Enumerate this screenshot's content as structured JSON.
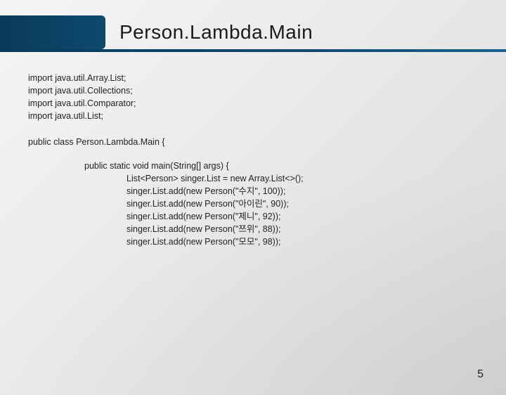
{
  "title": "Person.Lambda.Main",
  "imports": [
    "import java.util.Array.List;",
    "import java.util.Collections;",
    "import java.util.Comparator;",
    "import java.util.List;"
  ],
  "class_declaration": "public class Person.Lambda.Main {",
  "method_signature": "public static void main(String[] args) {",
  "method_body": [
    "List<Person> singer.List = new Array.List<>();",
    "singer.List.add(new Person(\"수지\", 100));",
    "singer.List.add(new Person(\"아이린\", 90));",
    "singer.List.add(new Person(\"제니\", 92));",
    "singer.List.add(new Person(\"쯔위\", 88));",
    "singer.List.add(new Person(\"모모\", 98));"
  ],
  "page_number": "5"
}
